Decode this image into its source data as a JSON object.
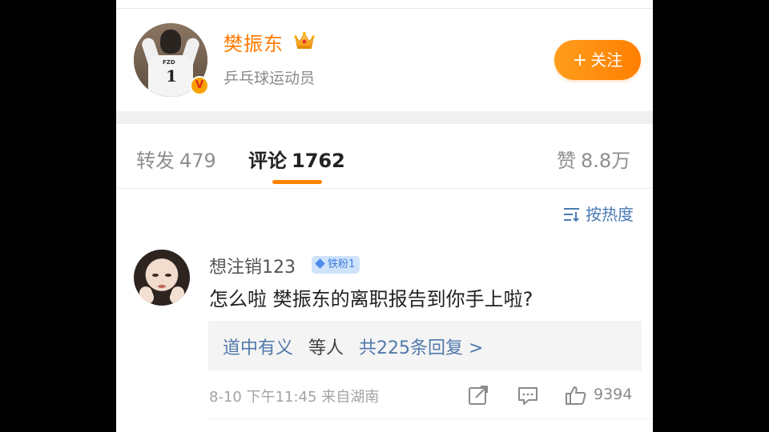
{
  "author": {
    "name": "樊振东",
    "description": "乒乓球运动员",
    "verified_badge": "V",
    "avatar_jersey_name": "FZD",
    "avatar_jersey_number": "1",
    "follow_label": "关注",
    "follow_plus": "+"
  },
  "tabs": [
    {
      "label": "转发",
      "count": "479"
    },
    {
      "label": "评论",
      "count": "1762"
    },
    {
      "label": "赞",
      "count": "8.8万"
    }
  ],
  "sort": {
    "label": "按热度",
    "icon": "sort-icon"
  },
  "comment": {
    "user": "想注销123",
    "fan_badge": "铁粉1",
    "text": "怎么啦 樊振东的离职报告到你手上啦?",
    "reply_users": "道中有义",
    "reply_etc": "等人",
    "reply_count": "共225条回复 >",
    "date": "8-10",
    "time": "下午11:45",
    "location": "来自湖南",
    "likes": "9394"
  },
  "colors": {
    "accent": "#ff8200",
    "link": "#5179ab",
    "badge_bg": "#cfe3fb"
  }
}
